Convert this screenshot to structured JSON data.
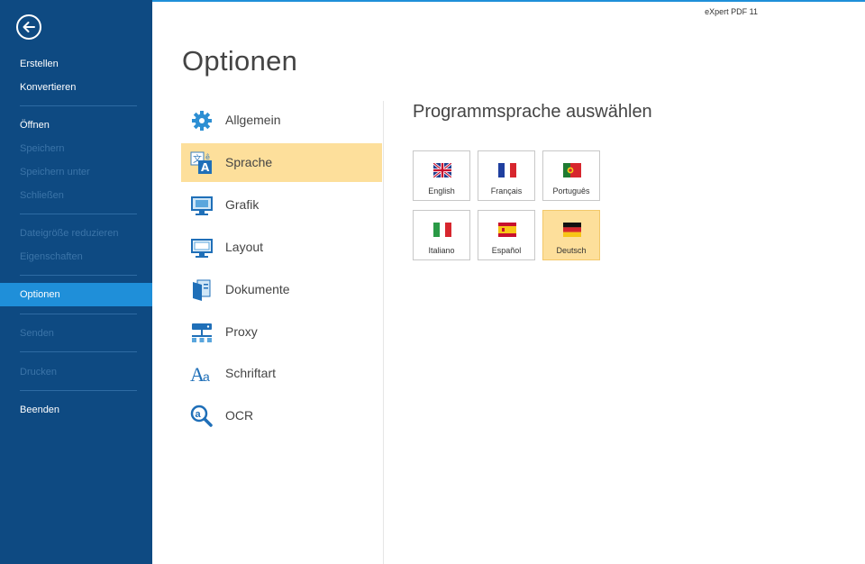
{
  "app": {
    "title": "eXpert PDF 11"
  },
  "page": {
    "title": "Optionen"
  },
  "sidebar": {
    "items": [
      {
        "label": "Erstellen"
      },
      {
        "label": "Konvertieren"
      },
      {
        "label": "Öffnen"
      },
      {
        "label": "Speichern"
      },
      {
        "label": "Speichern unter"
      },
      {
        "label": "Schließen"
      },
      {
        "label": "Dateigröße reduzieren"
      },
      {
        "label": "Eigenschaften"
      },
      {
        "label": "Optionen"
      },
      {
        "label": "Senden"
      },
      {
        "label": "Drucken"
      },
      {
        "label": "Beenden"
      }
    ]
  },
  "categories": [
    {
      "label": "Allgemein",
      "icon": "gear-icon"
    },
    {
      "label": "Sprache",
      "icon": "language-icon"
    },
    {
      "label": "Grafik",
      "icon": "monitor-icon"
    },
    {
      "label": "Layout",
      "icon": "layout-icon"
    },
    {
      "label": "Dokumente",
      "icon": "documents-icon"
    },
    {
      "label": "Proxy",
      "icon": "proxy-icon"
    },
    {
      "label": "Schriftart",
      "icon": "font-icon"
    },
    {
      "label": "OCR",
      "icon": "ocr-icon"
    }
  ],
  "language_panel": {
    "title": "Programmsprache auswählen",
    "languages": [
      {
        "label": "English",
        "flag": "uk-flag-icon"
      },
      {
        "label": "Français",
        "flag": "france-flag-icon"
      },
      {
        "label": "Português",
        "flag": "portugal-flag-icon"
      },
      {
        "label": "Italiano",
        "flag": "italy-flag-icon"
      },
      {
        "label": "Español",
        "flag": "spain-flag-icon"
      },
      {
        "label": "Deutsch",
        "flag": "germany-flag-icon"
      }
    ],
    "selected": "Deutsch"
  },
  "colors": {
    "sidebar": "#0e4a82",
    "sidebar_active": "#1f8fd9",
    "highlight": "#fddf9b",
    "accent": "#1f8fd9"
  }
}
